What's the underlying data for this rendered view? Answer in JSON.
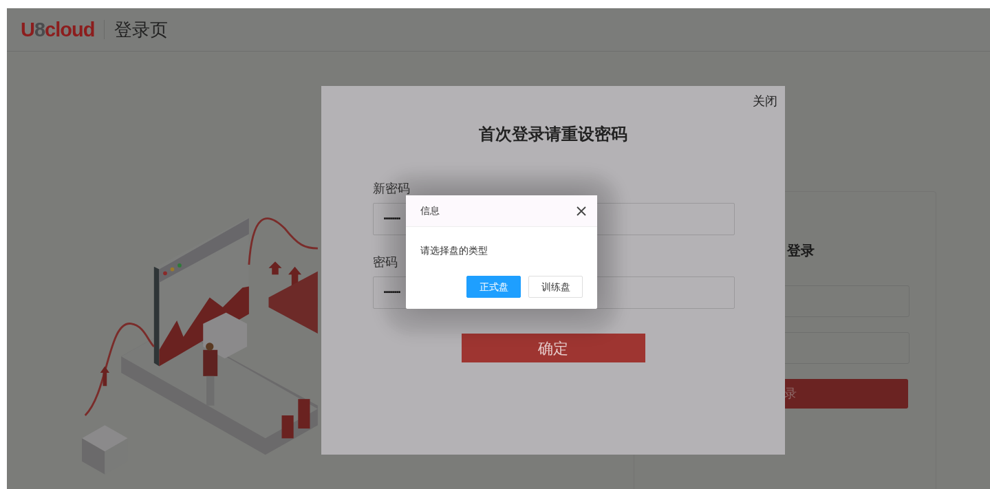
{
  "header": {
    "logo": "U8cloud",
    "title": "登录页"
  },
  "login_card": {
    "title": "登录",
    "button": "录"
  },
  "reset_modal": {
    "close": "关闭",
    "title": "首次登录请重设密码",
    "fields": [
      {
        "label": "新密码",
        "value": "········"
      },
      {
        "label": "密码",
        "value": "········"
      }
    ],
    "confirm": "确定"
  },
  "dialog": {
    "title": "信息",
    "message": "请选择盘的类型",
    "buttons": [
      {
        "label": "正式盘",
        "kind": "primary"
      },
      {
        "label": "训练盘",
        "kind": "default"
      }
    ]
  }
}
